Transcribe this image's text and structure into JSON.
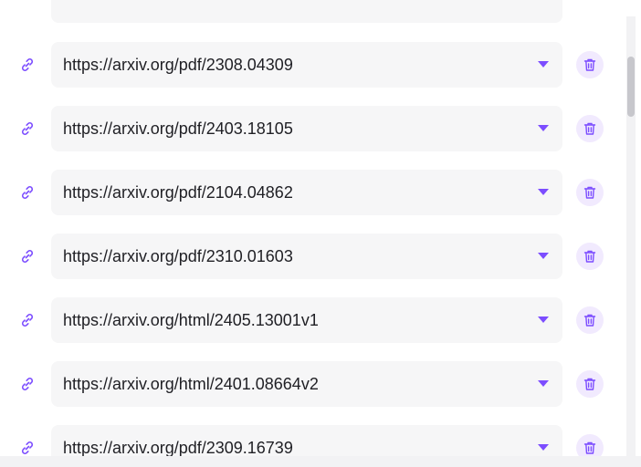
{
  "colors": {
    "accent": "#7c4dff",
    "field_bg": "#f6f6f7",
    "delete_bg": "#f1eafe"
  },
  "icons": {
    "row_icon": "link-icon",
    "delete_icon": "trash-icon",
    "dropdown_icon": "caret-down-icon"
  },
  "sources": [
    {
      "url": "https://arxiv.org/pdf/2308.04309"
    },
    {
      "url": "https://arxiv.org/pdf/2403.18105"
    },
    {
      "url": "https://arxiv.org/pdf/2104.04862"
    },
    {
      "url": "https://arxiv.org/pdf/2310.01603"
    },
    {
      "url": "https://arxiv.org/html/2405.13001v1"
    },
    {
      "url": "https://arxiv.org/html/2401.08664v2"
    },
    {
      "url": "https://arxiv.org/pdf/2309.16739"
    }
  ]
}
